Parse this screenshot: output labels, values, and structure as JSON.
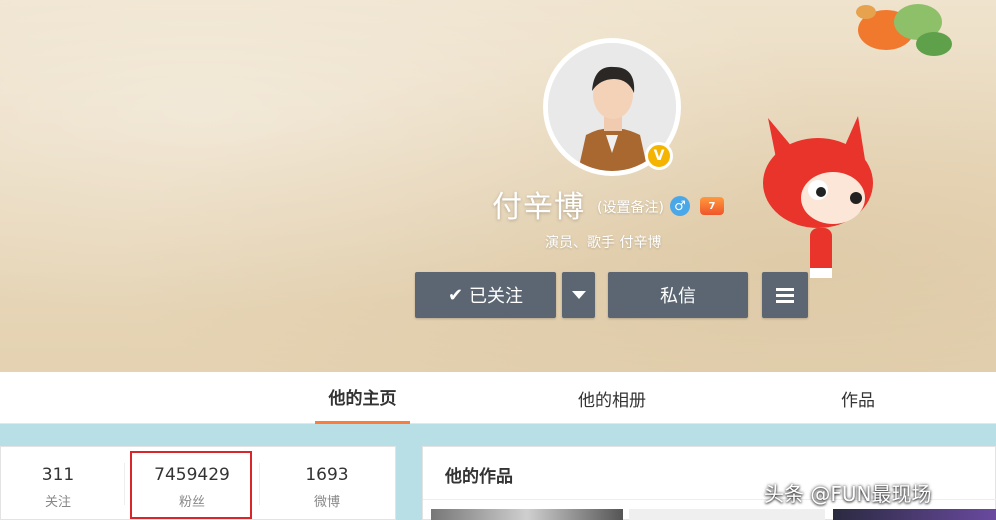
{
  "profile": {
    "name": "付辛博",
    "set_remark": "(设置备注)",
    "description": "演员、歌手 付辛博",
    "verified_badge": "V",
    "gender_icon": "♂",
    "vip_badge": "7"
  },
  "actions": {
    "follow_check": "✔",
    "follow_label": "已关注",
    "message_label": "私信"
  },
  "tabs": [
    {
      "label": "他的主页",
      "active": true
    },
    {
      "label": "他的相册",
      "active": false
    },
    {
      "label": "作品",
      "active": false
    }
  ],
  "stats": [
    {
      "value": "311",
      "label": "关注"
    },
    {
      "value": "7459429",
      "label": "粉丝"
    },
    {
      "value": "1693",
      "label": "微博"
    }
  ],
  "works": {
    "title": "他的作品"
  },
  "watermark": "头条 @FUN最现场",
  "colors": {
    "button_bg": "#5b6672",
    "tab_active_underline": "#fa7d3c",
    "highlight_box": "#d9262b",
    "verified_gold": "#f5b400",
    "page_bg": "#b9dfe6"
  }
}
